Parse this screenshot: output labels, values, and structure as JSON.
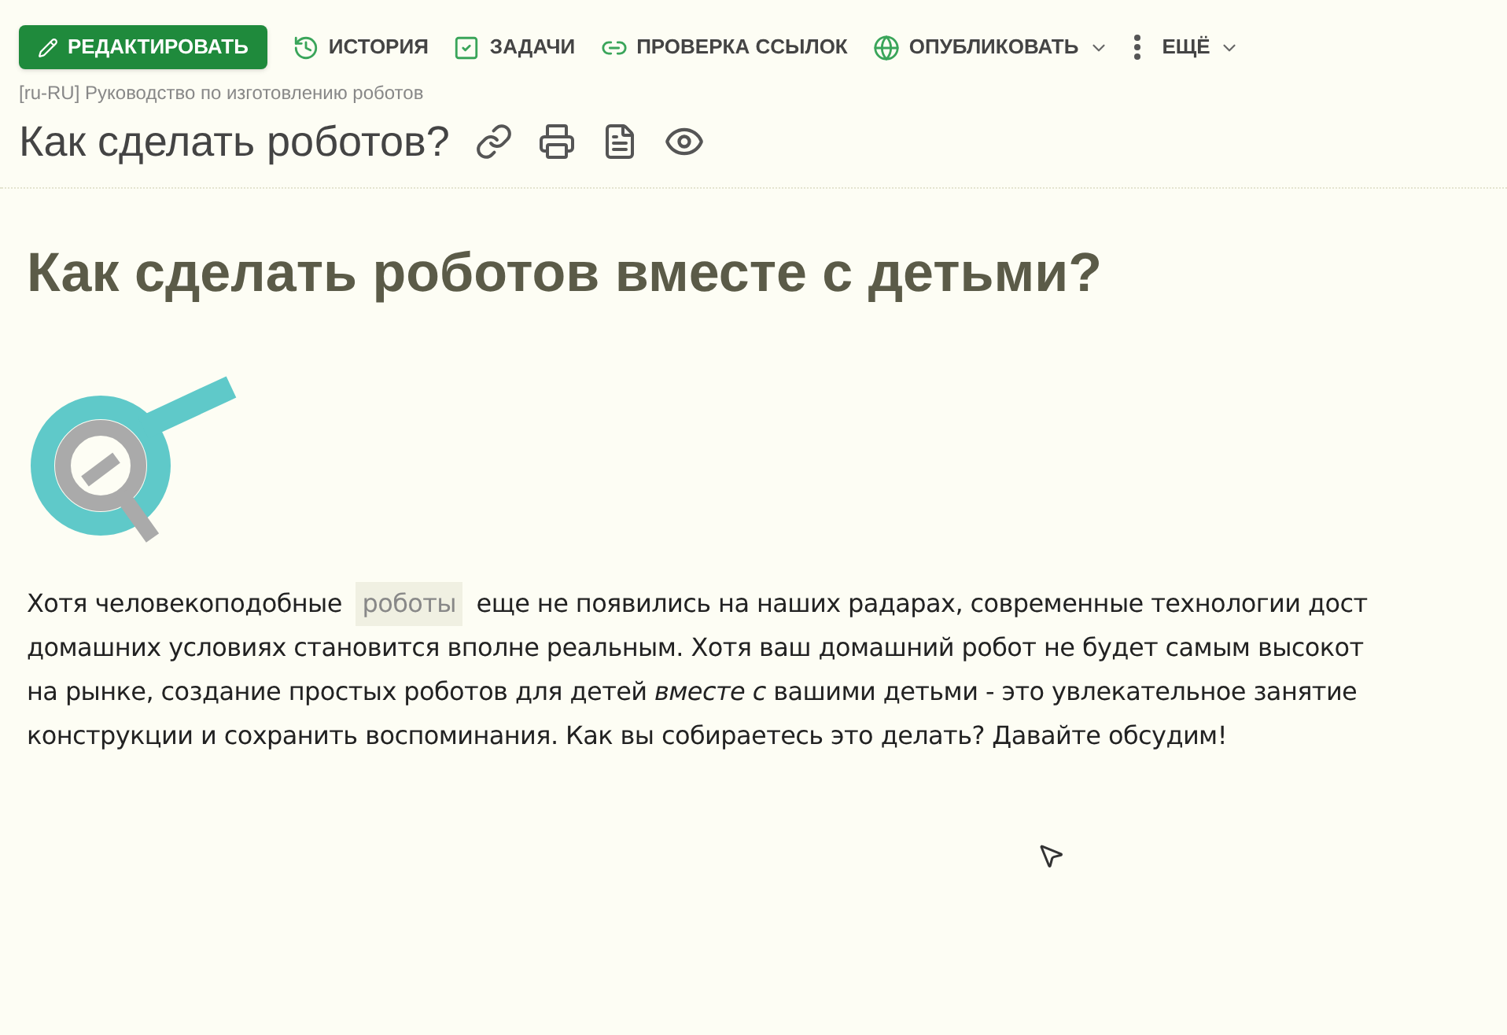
{
  "toolbar": [
    {
      "kind": "primary",
      "label": "РЕДАКТИРОВАТЬ"
    },
    {
      "kind": "plain",
      "label": "ИСТОРИЯ"
    },
    {
      "kind": "plain",
      "label": "ЗАДАЧИ"
    },
    {
      "kind": "plain",
      "label": "ПРОВЕРКА ССЫЛОК"
    },
    {
      "kind": "menu",
      "label": "ОПУБЛИКОВАТЬ"
    },
    {
      "kind": "menu",
      "label": "ЕЩЁ"
    }
  ],
  "breadcrumb": "[ru-RU] Руководство по изготовлению роботов",
  "page_title": "Как сделать роботов?",
  "article": {
    "heading": "Как сделать роботов вместе с детьми?",
    "lines": [
      [
        {
          "kind": "text",
          "text": "Хотя человекоподобные "
        },
        {
          "kind": "link",
          "text": "роботы"
        },
        {
          "kind": "text",
          "text": " еще не появились на наших радарах, современные технологии дост"
        }
      ],
      [
        {
          "kind": "text",
          "text": "домашних условиях становится вполне реальным. Хотя ваш домашний робот не будет самым высокот"
        }
      ],
      [
        {
          "kind": "text",
          "text": "на рынке, создание простых роботов для детей *вместе с* вашими детьми - это увлекательное занятие"
        }
      ],
      [
        {
          "kind": "text",
          "text": "конструкции и сохранить воспоминания. Как вы собираетесь это делать? Давайте обсудим!"
        }
      ]
    ]
  }
}
